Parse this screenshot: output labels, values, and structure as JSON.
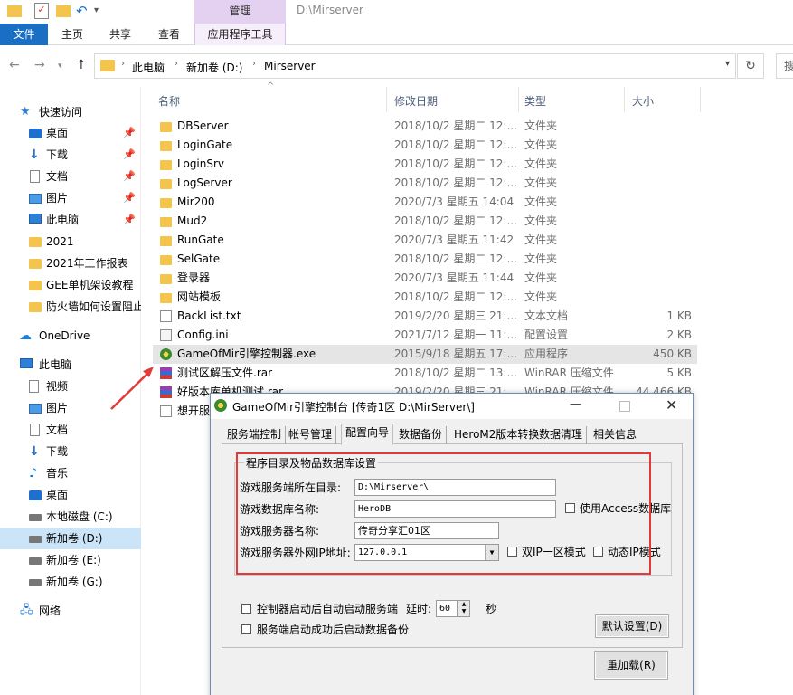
{
  "ribbon": {
    "context_header": "管理",
    "window_title": "D:\\Mirserver",
    "tabs": {
      "file": "文件",
      "home": "主页",
      "share": "共享",
      "view": "查看",
      "app_tools": "应用程序工具"
    }
  },
  "address": {
    "crumbs": [
      "此电脑",
      "新加卷 (D:)",
      "Mirserver"
    ]
  },
  "sidebar": {
    "items": [
      {
        "label": "快速访问",
        "icon": "star-icon"
      },
      {
        "label": "桌面",
        "icon": "desktop-icon",
        "pinned": true
      },
      {
        "label": "下载",
        "icon": "download-icon",
        "pinned": true
      },
      {
        "label": "文档",
        "icon": "document-icon",
        "pinned": true
      },
      {
        "label": "图片",
        "icon": "pictures-icon",
        "pinned": true
      },
      {
        "label": "此电脑",
        "icon": "computer-icon",
        "pinned": true
      },
      {
        "label": "2021",
        "icon": "folder-icon"
      },
      {
        "label": "2021年工作报表",
        "icon": "folder-icon"
      },
      {
        "label": "GEE单机架设教程",
        "icon": "folder-icon"
      },
      {
        "label": "防火墙如何设置阻止",
        "icon": "folder-icon"
      },
      {
        "label": "OneDrive",
        "icon": "cloud-icon"
      },
      {
        "label": "此电脑",
        "icon": "computer-icon"
      },
      {
        "label": "视频",
        "icon": "video-icon"
      },
      {
        "label": "图片",
        "icon": "pictures-icon"
      },
      {
        "label": "文档",
        "icon": "document-icon"
      },
      {
        "label": "下载",
        "icon": "download-icon"
      },
      {
        "label": "音乐",
        "icon": "music-icon"
      },
      {
        "label": "桌面",
        "icon": "desktop-icon"
      },
      {
        "label": "本地磁盘 (C:)",
        "icon": "drive-icon"
      },
      {
        "label": "新加卷 (D:)",
        "icon": "drive-icon",
        "selected": true
      },
      {
        "label": "新加卷 (E:)",
        "icon": "drive-icon"
      },
      {
        "label": "新加卷 (G:)",
        "icon": "drive-icon"
      },
      {
        "label": "网络",
        "icon": "network-icon"
      }
    ],
    "pin_glyph": "📌"
  },
  "files": {
    "columns": {
      "name": "名称",
      "date": "修改日期",
      "type": "类型",
      "size": "大小"
    },
    "rows": [
      {
        "name": "DBServer",
        "date": "2018/10/2 星期二 12:...",
        "type": "文件夹",
        "size": "",
        "kind": "folder"
      },
      {
        "name": "LoginGate",
        "date": "2018/10/2 星期二 12:...",
        "type": "文件夹",
        "size": "",
        "kind": "folder"
      },
      {
        "name": "LoginSrv",
        "date": "2018/10/2 星期二 12:...",
        "type": "文件夹",
        "size": "",
        "kind": "folder"
      },
      {
        "name": "LogServer",
        "date": "2018/10/2 星期二 12:...",
        "type": "文件夹",
        "size": "",
        "kind": "folder"
      },
      {
        "name": "Mir200",
        "date": "2020/7/3 星期五 14:04",
        "type": "文件夹",
        "size": "",
        "kind": "folder"
      },
      {
        "name": "Mud2",
        "date": "2018/10/2 星期二 12:...",
        "type": "文件夹",
        "size": "",
        "kind": "folder"
      },
      {
        "name": "RunGate",
        "date": "2020/7/3 星期五 11:42",
        "type": "文件夹",
        "size": "",
        "kind": "folder"
      },
      {
        "name": "SelGate",
        "date": "2018/10/2 星期二 12:...",
        "type": "文件夹",
        "size": "",
        "kind": "folder"
      },
      {
        "name": "登录器",
        "date": "2020/7/3 星期五 11:44",
        "type": "文件夹",
        "size": "",
        "kind": "folder"
      },
      {
        "name": "网站模板",
        "date": "2018/10/2 星期二 12:...",
        "type": "文件夹",
        "size": "",
        "kind": "folder"
      },
      {
        "name": "BackList.txt",
        "date": "2019/2/20 星期三 21:...",
        "type": "文本文档",
        "size": "1 KB",
        "kind": "txt"
      },
      {
        "name": "Config.ini",
        "date": "2021/7/12 星期一 11:...",
        "type": "配置设置",
        "size": "2 KB",
        "kind": "ini"
      },
      {
        "name": "GameOfMir引擎控制器.exe",
        "date": "2015/9/18 星期五 17:...",
        "type": "应用程序",
        "size": "450 KB",
        "kind": "exe",
        "highlight": true
      },
      {
        "name": "测试区解压文件.rar",
        "date": "2018/10/2 星期二 13:...",
        "type": "WinRAR 压缩文件",
        "size": "5 KB",
        "kind": "rar"
      },
      {
        "name": "好版本库单机测试.rar",
        "date": "2019/2/20 星期三 21:...",
        "type": "WinRAR 压缩文件",
        "size": "44,466 KB",
        "kind": "rar"
      },
      {
        "name": "想开服",
        "date": "",
        "type": "",
        "size": "",
        "kind": "txt"
      }
    ]
  },
  "dialog": {
    "title": "GameOfMir引擎控制台 [传奇1区 D:\\MirServer\\]",
    "tabs": [
      "服务端控制",
      "帐号管理",
      "配置向导",
      "数据备份",
      "HeroM2版本转换",
      "数据清理",
      "相关信息"
    ],
    "active_tab": 2,
    "group_title": "程序目录及物品数据库设置",
    "fields": {
      "dir_label": "游戏服务端所在目录:",
      "dir_value": "D:\\Mirserver\\",
      "db_label": "游戏数据库名称:",
      "db_value": "HeroDB",
      "use_access_label": "使用Access数据库",
      "name_label": "游戏服务器名称:",
      "name_value": "传奇分享汇01区",
      "ip_label": "游戏服务器外网IP地址:",
      "ip_value": "127.0.0.1",
      "dual_ip_label": "双IP一区模式",
      "dynamic_ip_label": "动态IP模式"
    },
    "options": {
      "autostart_label": "控制器启动后自动启动服务端",
      "delay_label": "延时:",
      "delay_value": "60",
      "seconds_label": "秒",
      "autobackup_label": "服务端启动成功后启动数据备份"
    },
    "buttons": {
      "default": "默认设置(D)",
      "reload": "重加载(R)"
    }
  },
  "colors": {
    "accent": "#1a6fc4",
    "context_tab": "#e4d0f0",
    "annotation_red": "#e23a3a",
    "folder": "#f3c54d"
  }
}
